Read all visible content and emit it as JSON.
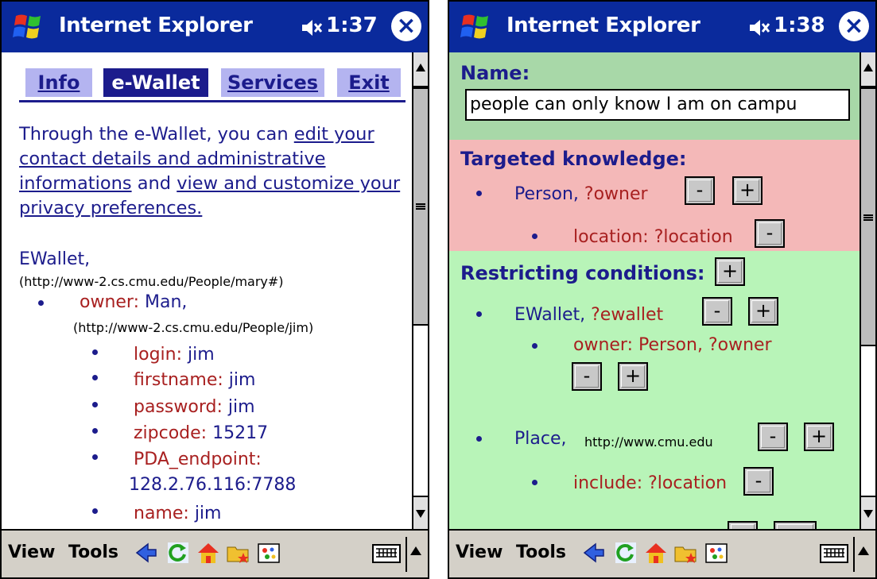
{
  "screen1": {
    "titlebar": {
      "title": "Internet Explorer",
      "time": "1:37",
      "close": "×"
    },
    "tabs": [
      "Info",
      "e-Wallet",
      "Services",
      "Exit"
    ],
    "intro": {
      "text1": "Through the e-Wallet, you can ",
      "link1": "edit your contact details and administrative informations",
      "text2": " and ",
      "link2": "view and customize your privacy preferences."
    },
    "ewallet_label": "EWallet,",
    "ewallet_url": "(http://www-2.cs.cmu.edu/People/mary#)",
    "owner_key": "owner:",
    "owner_val": "Man,",
    "owner_url": "(http://www-2.cs.cmu.edu/People/jim)",
    "props": [
      {
        "key": "login:",
        "val": "jim"
      },
      {
        "key": "firstname:",
        "val": "jim"
      },
      {
        "key": "password:",
        "val": "jim"
      },
      {
        "key": "zipcode:",
        "val": "15217"
      },
      {
        "key": "PDA_endpoint:",
        "val": "128.2.76.116:7788"
      },
      {
        "key": "name:",
        "val": "jim"
      }
    ],
    "menubar": {
      "view": "View",
      "tools": "Tools"
    }
  },
  "screen2": {
    "titlebar": {
      "title": "Internet Explorer",
      "time": "1:38",
      "close": "×"
    },
    "name_label": "Name:",
    "name_value": "people can only know I am on campu",
    "targeted_label": "Targeted knowledge:",
    "person_label": "Person,",
    "person_var": "?owner",
    "location_label": "location:",
    "location_var": "?location",
    "restricting_label": "Restricting conditions:",
    "ewallet_label": "EWallet,",
    "ewallet_var": "?ewallet",
    "owner_label": "owner:",
    "owner_val": "Person,",
    "owner_var": "?owner",
    "place_label": "Place,",
    "place_url": "http://www.cmu.edu",
    "include_label": "include:",
    "include_var": "?location",
    "minus": "-",
    "plus": "+",
    "menubar": {
      "view": "View",
      "tools": "Tools"
    }
  },
  "colors": {
    "titlebar": "#0a2a9c",
    "name_band": "#a8d8a8",
    "targeted_band": "#f4b8b8",
    "restricting_band": "#b8f4b8",
    "link_blue": "#1c1c8c",
    "key_red": "#a82020"
  }
}
